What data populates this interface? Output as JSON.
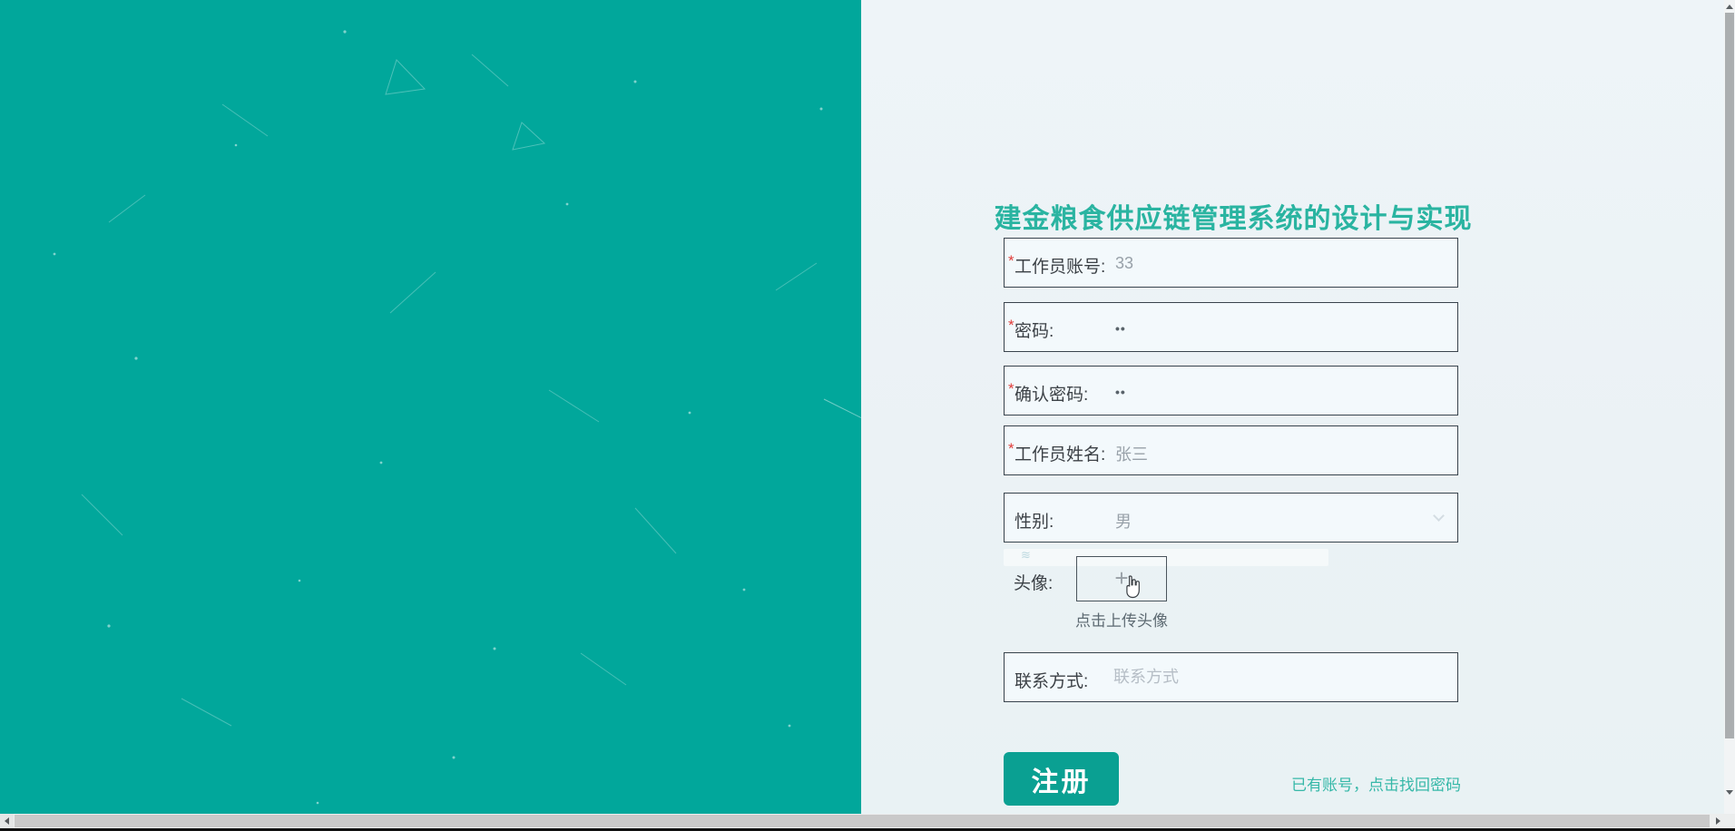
{
  "page": {
    "title": "建金粮食供应链管理系统的设计与实现"
  },
  "form": {
    "required_marker": "*",
    "fields": [
      {
        "label": "工作员账号:",
        "value": "33",
        "required": true
      },
      {
        "label": "密码:",
        "value": "••",
        "required": true,
        "masked": true
      },
      {
        "label": "确认密码:",
        "value": "••",
        "required": true,
        "masked": true
      },
      {
        "label": "工作员姓名:",
        "value": "张三",
        "required": true
      },
      {
        "label": "性别:",
        "value": "男",
        "required": false
      }
    ],
    "avatar": {
      "label": "头像:",
      "plus_icon": "+",
      "hint": "点击上传头像"
    },
    "contact": {
      "label": "联系方式:",
      "placeholder": "联系方式"
    },
    "register_button": "注册",
    "login_link": "已有账号，点击找回密码"
  },
  "colors": {
    "left_panel": "#01a79b",
    "right_panel_bg": "#edf3f7",
    "title": "#2ab4a1",
    "button": "#0aa092",
    "link": "#36b8a8",
    "required": "#e13c39",
    "field_border": "#39434c"
  }
}
